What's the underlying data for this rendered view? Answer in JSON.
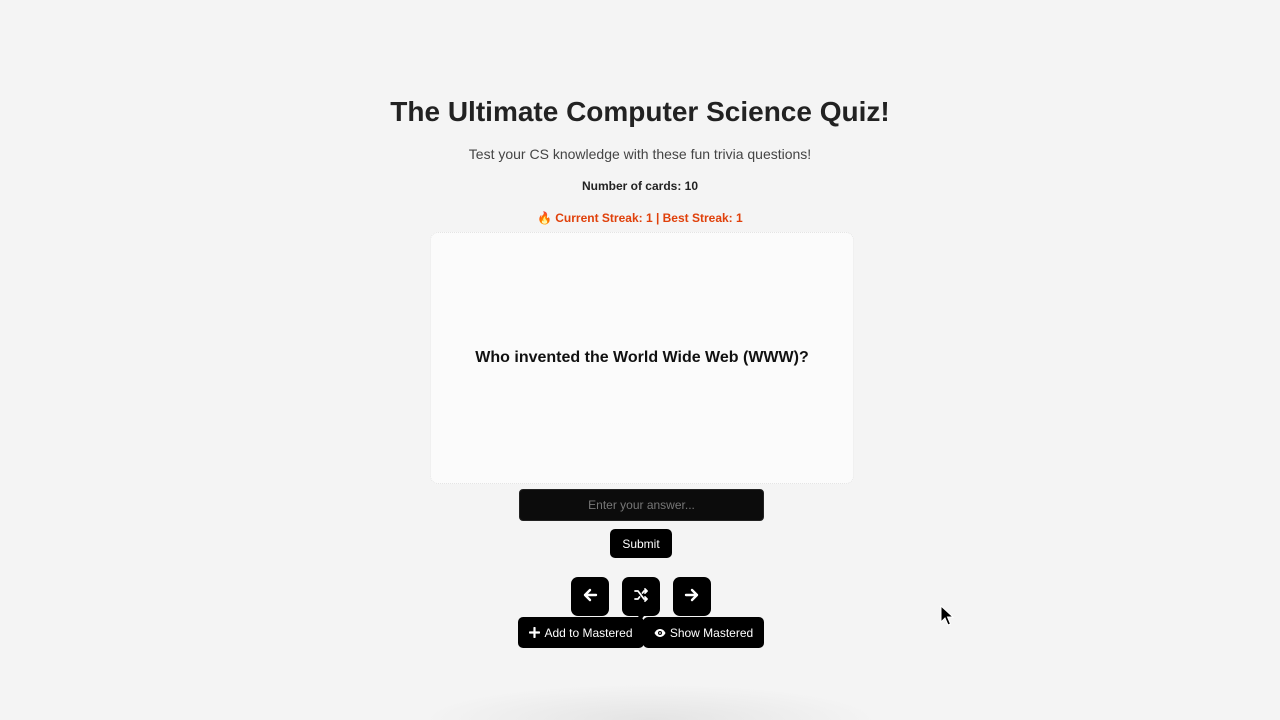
{
  "header": {
    "title": "The Ultimate Computer Science Quiz!",
    "subtitle": "Test your CS knowledge with these fun trivia questions!",
    "card_count": "Number of cards: 10"
  },
  "streak": {
    "text": "Current Streak: 1 | Best Streak: 1",
    "icon": "fire-icon",
    "color": "#e0400a"
  },
  "card": {
    "question": "Who invented the World Wide Web (WWW)?"
  },
  "answer": {
    "placeholder": "Enter your answer...",
    "value": ""
  },
  "buttons": {
    "submit": "Submit",
    "previous_icon": "arrow-left-icon",
    "shuffle_icon": "shuffle-icon",
    "next_icon": "arrow-right-icon",
    "add_mastered": "Add to Mastered",
    "show_mastered": "Show Mastered"
  }
}
